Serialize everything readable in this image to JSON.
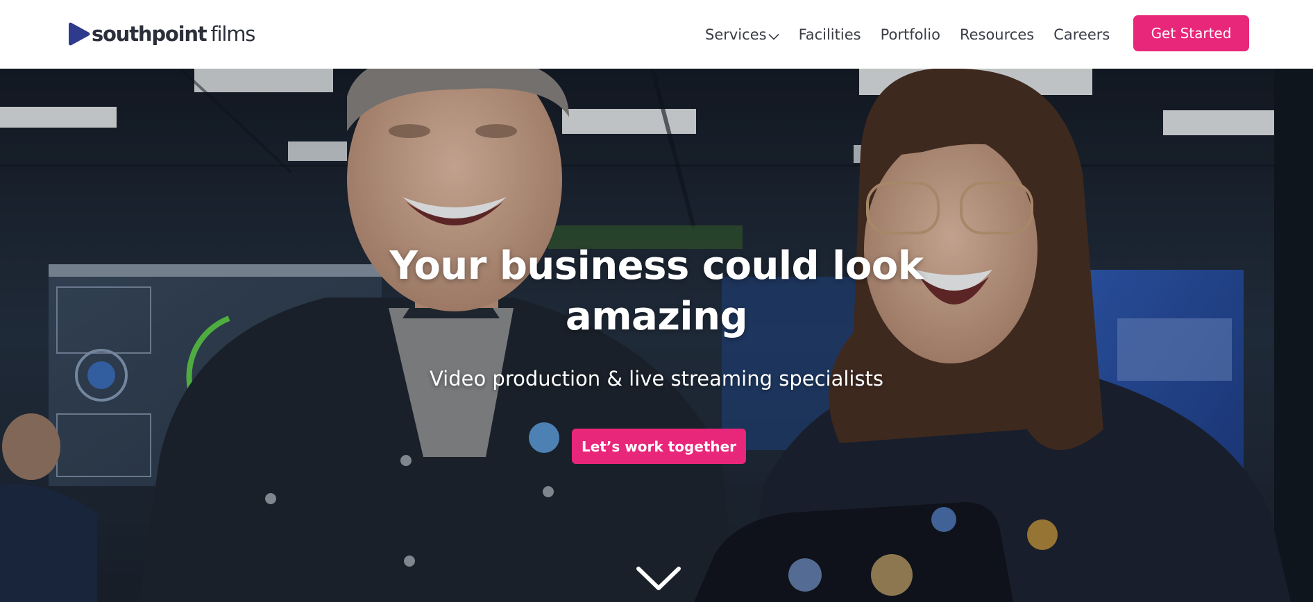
{
  "header": {
    "logo": {
      "bold_text": "southpoint",
      "light_text": "films",
      "icon": "play-triangle-icon",
      "brand_color": "#2e3a8c"
    },
    "nav": {
      "services": "Services",
      "facilities": "Facilities",
      "portfolio": "Portfolio",
      "resources": "Resources",
      "careers": "Careers"
    },
    "cta_label": "Get Started"
  },
  "hero": {
    "title": "Your business could look amazing",
    "subtitle": "Video production & live streaming specialists",
    "cta_label": "Let’s work together",
    "scroll_icon": "chevron-down-icon",
    "background_image": "two presenters laughing in a broadcast control room"
  },
  "colors": {
    "accent": "#e8267a",
    "text": "#3a3d45",
    "hero_text": "#ffffff"
  }
}
